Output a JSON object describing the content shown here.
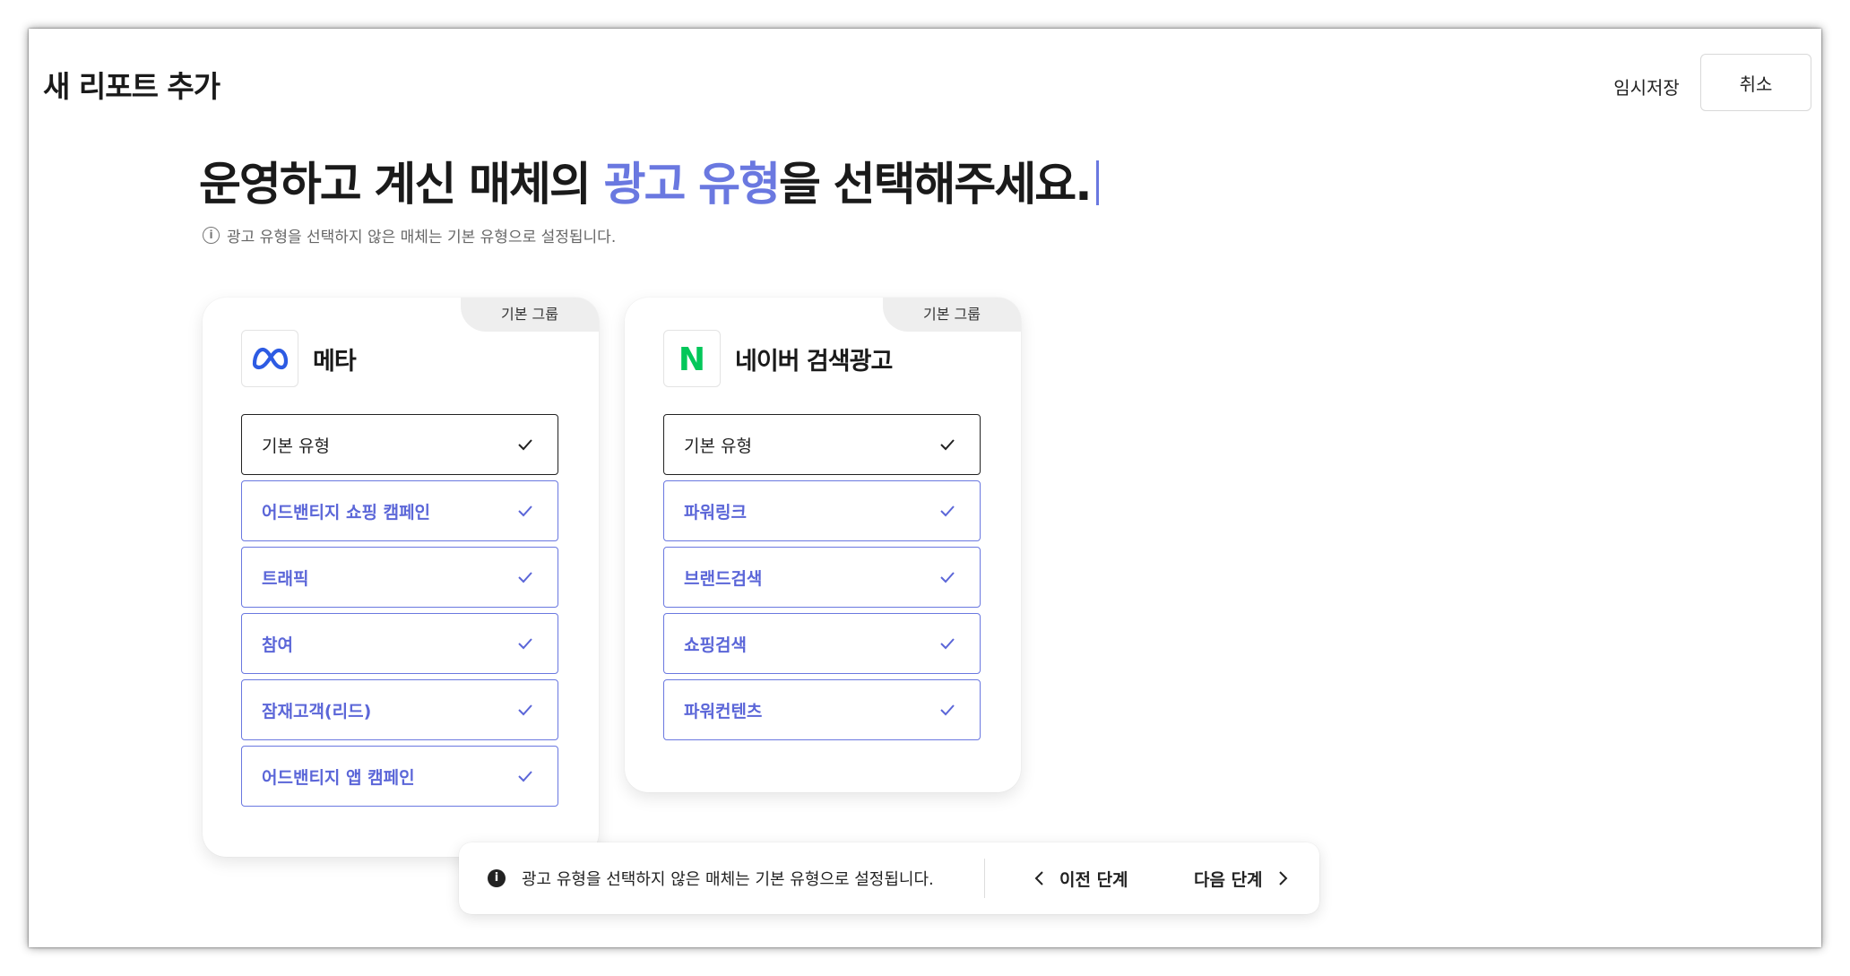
{
  "header": {
    "title": "새 리포트 추가",
    "temp_save_label": "임시저장",
    "cancel_label": "취소"
  },
  "headline": {
    "before": "운영하고 계신 매체의 ",
    "accent": "광고 유형",
    "after": "을 선택해주세요."
  },
  "sub_info": "광고 유형을 선택하지 않은 매체는 기본 유형으로 설정됩니다.",
  "colors": {
    "accent": "#6a78e0",
    "meta_logo": "#2d5be3",
    "naver_logo": "#03c75a"
  },
  "media": [
    {
      "group_tag": "기본 그룹",
      "name": "메타",
      "logo_icon": "meta-logo-icon",
      "options": [
        {
          "label": "기본 유형",
          "selected": true,
          "default": true
        },
        {
          "label": "어드밴티지 쇼핑 캠페인",
          "selected": true,
          "default": false
        },
        {
          "label": "트래픽",
          "selected": true,
          "default": false
        },
        {
          "label": "참여",
          "selected": true,
          "default": false
        },
        {
          "label": "잠재고객(리드)",
          "selected": true,
          "default": false
        },
        {
          "label": "어드밴티지 앱 캠페인",
          "selected": true,
          "default": false
        }
      ]
    },
    {
      "group_tag": "기본 그룹",
      "name": "네이버 검색광고",
      "logo_icon": "naver-logo-icon",
      "logo_letter": "N",
      "options": [
        {
          "label": "기본 유형",
          "selected": true,
          "default": true
        },
        {
          "label": "파워링크",
          "selected": true,
          "default": false
        },
        {
          "label": "브랜드검색",
          "selected": true,
          "default": false
        },
        {
          "label": "쇼핑검색",
          "selected": true,
          "default": false
        },
        {
          "label": "파워컨텐츠",
          "selected": true,
          "default": false
        }
      ]
    }
  ],
  "bottom_bar": {
    "info": "광고 유형을 선택하지 않은 매체는 기본 유형으로 설정됩니다.",
    "prev_label": "이전 단계",
    "next_label": "다음 단계"
  }
}
